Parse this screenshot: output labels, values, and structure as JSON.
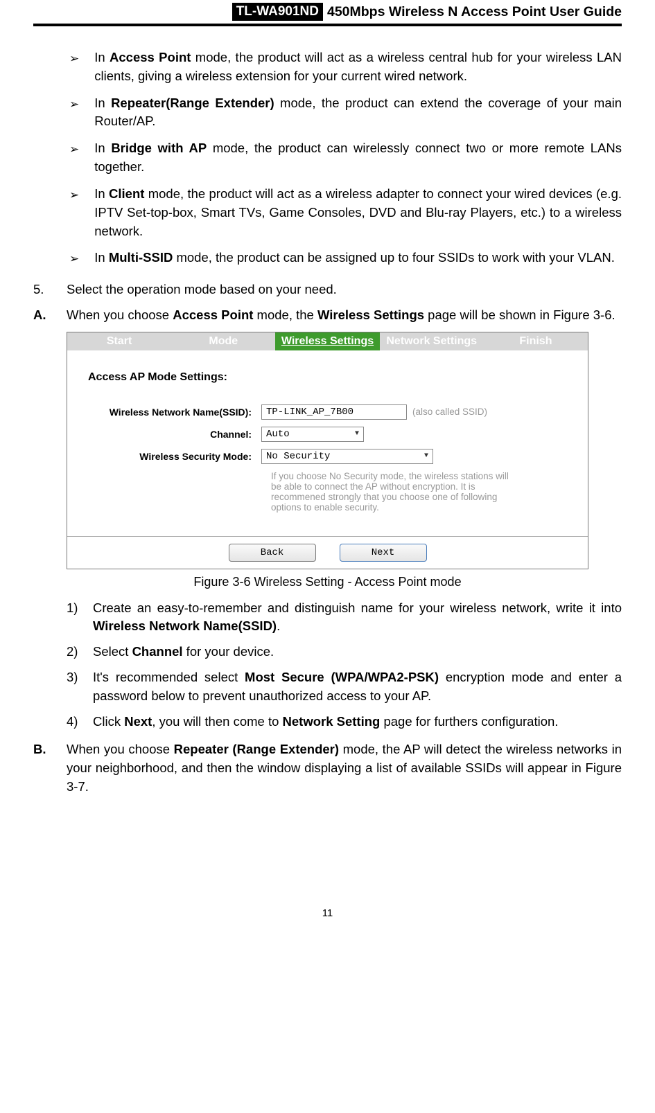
{
  "header": {
    "model": "TL-WA901ND",
    "title": "450Mbps Wireless N Access Point User Guide"
  },
  "bullets": [
    {
      "strong": "Access Point",
      "pre": "In ",
      "post": " mode, the product will act as a wireless central hub for your wireless LAN clients, giving a wireless extension for your current wired network."
    },
    {
      "strong": "Repeater(Range Extender)",
      "pre": "In ",
      "post": " mode, the product can extend the coverage of your main Router/AP."
    },
    {
      "strong": "Bridge with AP",
      "pre": "In ",
      "post": " mode, the product can wirelessly connect two or more remote LANs together."
    },
    {
      "strong": "Client",
      "pre": "In ",
      "post": " mode, the product will act as a wireless adapter to connect your wired devices (e.g. IPTV Set-top-box, Smart TVs, Game Consoles, DVD and Blu-ray Players, etc.) to a wireless network."
    },
    {
      "strong": "Multi-SSID",
      "pre": "In ",
      "post": " mode, the product can be assigned up to four SSIDs to work with your VLAN."
    }
  ],
  "step5": {
    "marker": "5.",
    "text": "Select the operation mode based on your need."
  },
  "stepA": {
    "marker": "A.",
    "pre": "When you choose ",
    "strong1": "Access Point",
    "mid": " mode, the ",
    "strong2": "Wireless Settings",
    "post": " page will be shown in Figure 3-6."
  },
  "figure": {
    "tabs": [
      "Start",
      "Mode",
      "Wireless Settings",
      "Network Settings",
      "Finish"
    ],
    "active_tab_index": 2,
    "heading": "Access AP Mode Settings:",
    "rows": {
      "ssid": {
        "label": "Wireless Network Name(SSID):",
        "value": "TP-LINK_AP_7B00",
        "hint": "(also called SSID)"
      },
      "channel": {
        "label": "Channel:",
        "value": "Auto"
      },
      "security": {
        "label": "Wireless Security Mode:",
        "value": "No Security"
      }
    },
    "hint": "If you choose No Security mode, the wireless stations will be able to connect the AP without encryption. It is recommened strongly that you choose one of following options to enable security.",
    "buttons": {
      "back": "Back",
      "next": "Next"
    },
    "caption": "Figure 3-6 Wireless Setting - Access Point mode"
  },
  "substeps": [
    {
      "marker": "1)",
      "pre": "Create an easy-to-remember and distinguish name for your wireless network, write it into ",
      "strong": "Wireless Network Name(SSID)",
      "post": "."
    },
    {
      "marker": "2)",
      "pre": "Select ",
      "strong": "Channel",
      "post": " for your device."
    },
    {
      "marker": "3)",
      "pre": "It's recommended select ",
      "strong": "Most Secure (WPA/WPA2-PSK)",
      "post": " encryption mode and enter a password below to prevent unauthorized access to your AP."
    },
    {
      "marker": "4)",
      "pre": "Click ",
      "strong": "Next",
      "mid": ", you will then come to ",
      "strong2": "Network Setting",
      "post": " page for furthers configuration."
    }
  ],
  "stepB": {
    "marker": "B.",
    "pre": "When you choose ",
    "strong": "Repeater (Range Extender)",
    "post": " mode, the AP will detect the wireless networks in your neighborhood, and then the window displaying a list of available SSIDs will appear in Figure 3-7."
  },
  "page_number": "11"
}
